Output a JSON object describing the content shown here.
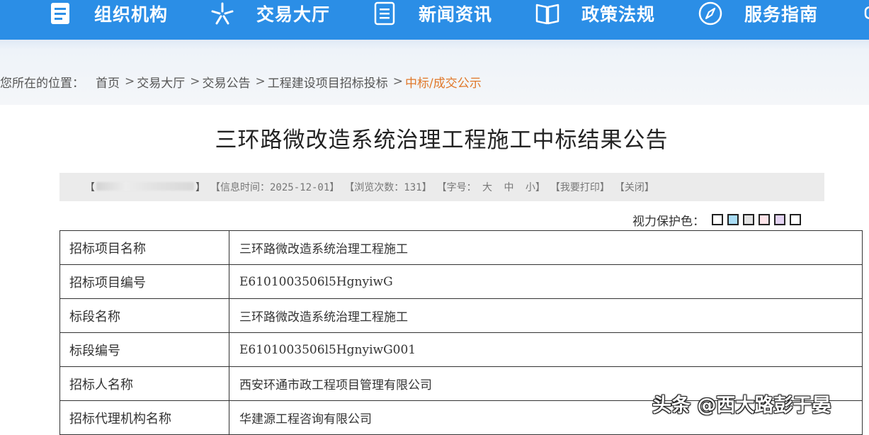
{
  "nav": {
    "items": [
      {
        "label": "组织机构",
        "icon": "document-icon"
      },
      {
        "label": "交易大厅",
        "icon": "star-icon"
      },
      {
        "label": "新闻资讯",
        "icon": "list-icon"
      },
      {
        "label": "政策法规",
        "icon": "book-icon"
      },
      {
        "label": "服务指南",
        "icon": "compass-icon"
      }
    ],
    "background_color": "#2b8ee6"
  },
  "breadcrumb": {
    "prefix": "您所在的位置：",
    "separator": ">",
    "items": [
      "首页",
      "交易大厅",
      "交易公告",
      "工程建设项目招标投标"
    ],
    "current": "中标/成交公示",
    "current_color": "#e0782a"
  },
  "title": "三环路微改造系统治理工程施工中标结果公告",
  "info_bar": {
    "open_bracket": "【",
    "close_bracket": "】",
    "time_label": "信息时间：2025-12-01",
    "views_label": "浏览次数：131",
    "font_label": "字号：",
    "font_large": "大",
    "font_medium": "中",
    "font_small": "小",
    "print_label": "我要打印",
    "close_label": "关闭"
  },
  "eye_care": {
    "label": "视力保护色：",
    "colors": [
      "#ffffff",
      "#a9dcf5",
      "#e2e2e2",
      "#fde3e8",
      "#e3d3f2",
      "#ffffff"
    ]
  },
  "table": {
    "rows": [
      {
        "key": "招标项目名称",
        "value": "三环路微改造系统治理工程施工"
      },
      {
        "key": "招标项目编号",
        "value": "E6101003506l5HgnyiwG"
      },
      {
        "key": "标段名称",
        "value": "三环路微改造系统治理工程施工"
      },
      {
        "key": "标段编号",
        "value": "E6101003506l5HgnyiwG001"
      },
      {
        "key": "招标人名称",
        "value": "西安环通市政工程项目管理有限公司"
      },
      {
        "key": "招标代理机构名称",
        "value": "华建源工程咨询有限公司"
      }
    ]
  },
  "watermark": "头条 @西大路彭于晏"
}
